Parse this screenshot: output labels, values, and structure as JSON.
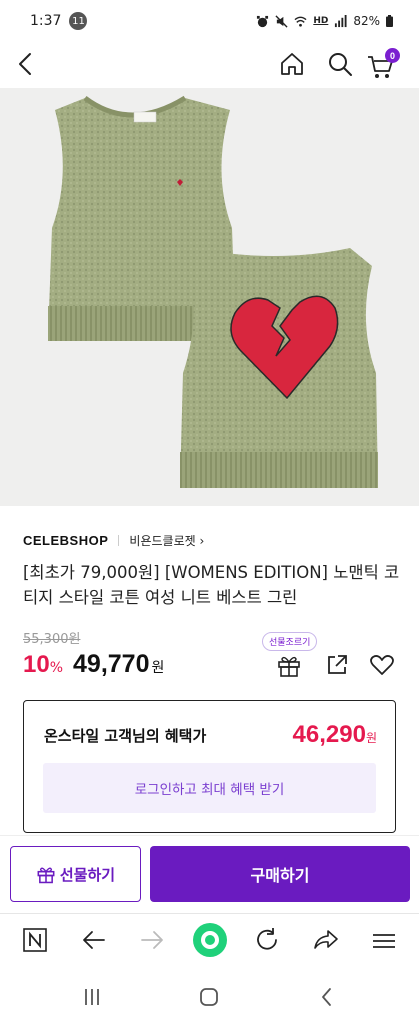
{
  "status_bar": {
    "time": "1:37",
    "notification_count": "11",
    "network": "HD",
    "battery": "82%"
  },
  "header": {
    "cart_count": "0"
  },
  "product": {
    "brand": "CELEBSHOP",
    "store_link": "비욘드클로젯 ›",
    "title": "[최초가 79,000원] [WOMENS EDITION] 노맨틱 코티지 스타일 코튼 여성 니트 베스트 그린",
    "original_price": "55,300원",
    "discount_value": "10",
    "discount_unit": "%",
    "sale_price": "49,770",
    "currency": "원",
    "gift_tooltip": "선물조르기"
  },
  "benefit": {
    "label": "온스타일 고객님의 혜택가",
    "price": "46,290",
    "currency": "원",
    "login_button": "로그인하고 최대 혜택 받기"
  },
  "purchase": {
    "gift_button": "선물하기",
    "buy_button": "구매하기"
  },
  "colors": {
    "accent_purple": "#6a1bc0",
    "price_red": "#e5194e",
    "vest_green": "#a3ad82",
    "heart_red": "#d8263e"
  }
}
